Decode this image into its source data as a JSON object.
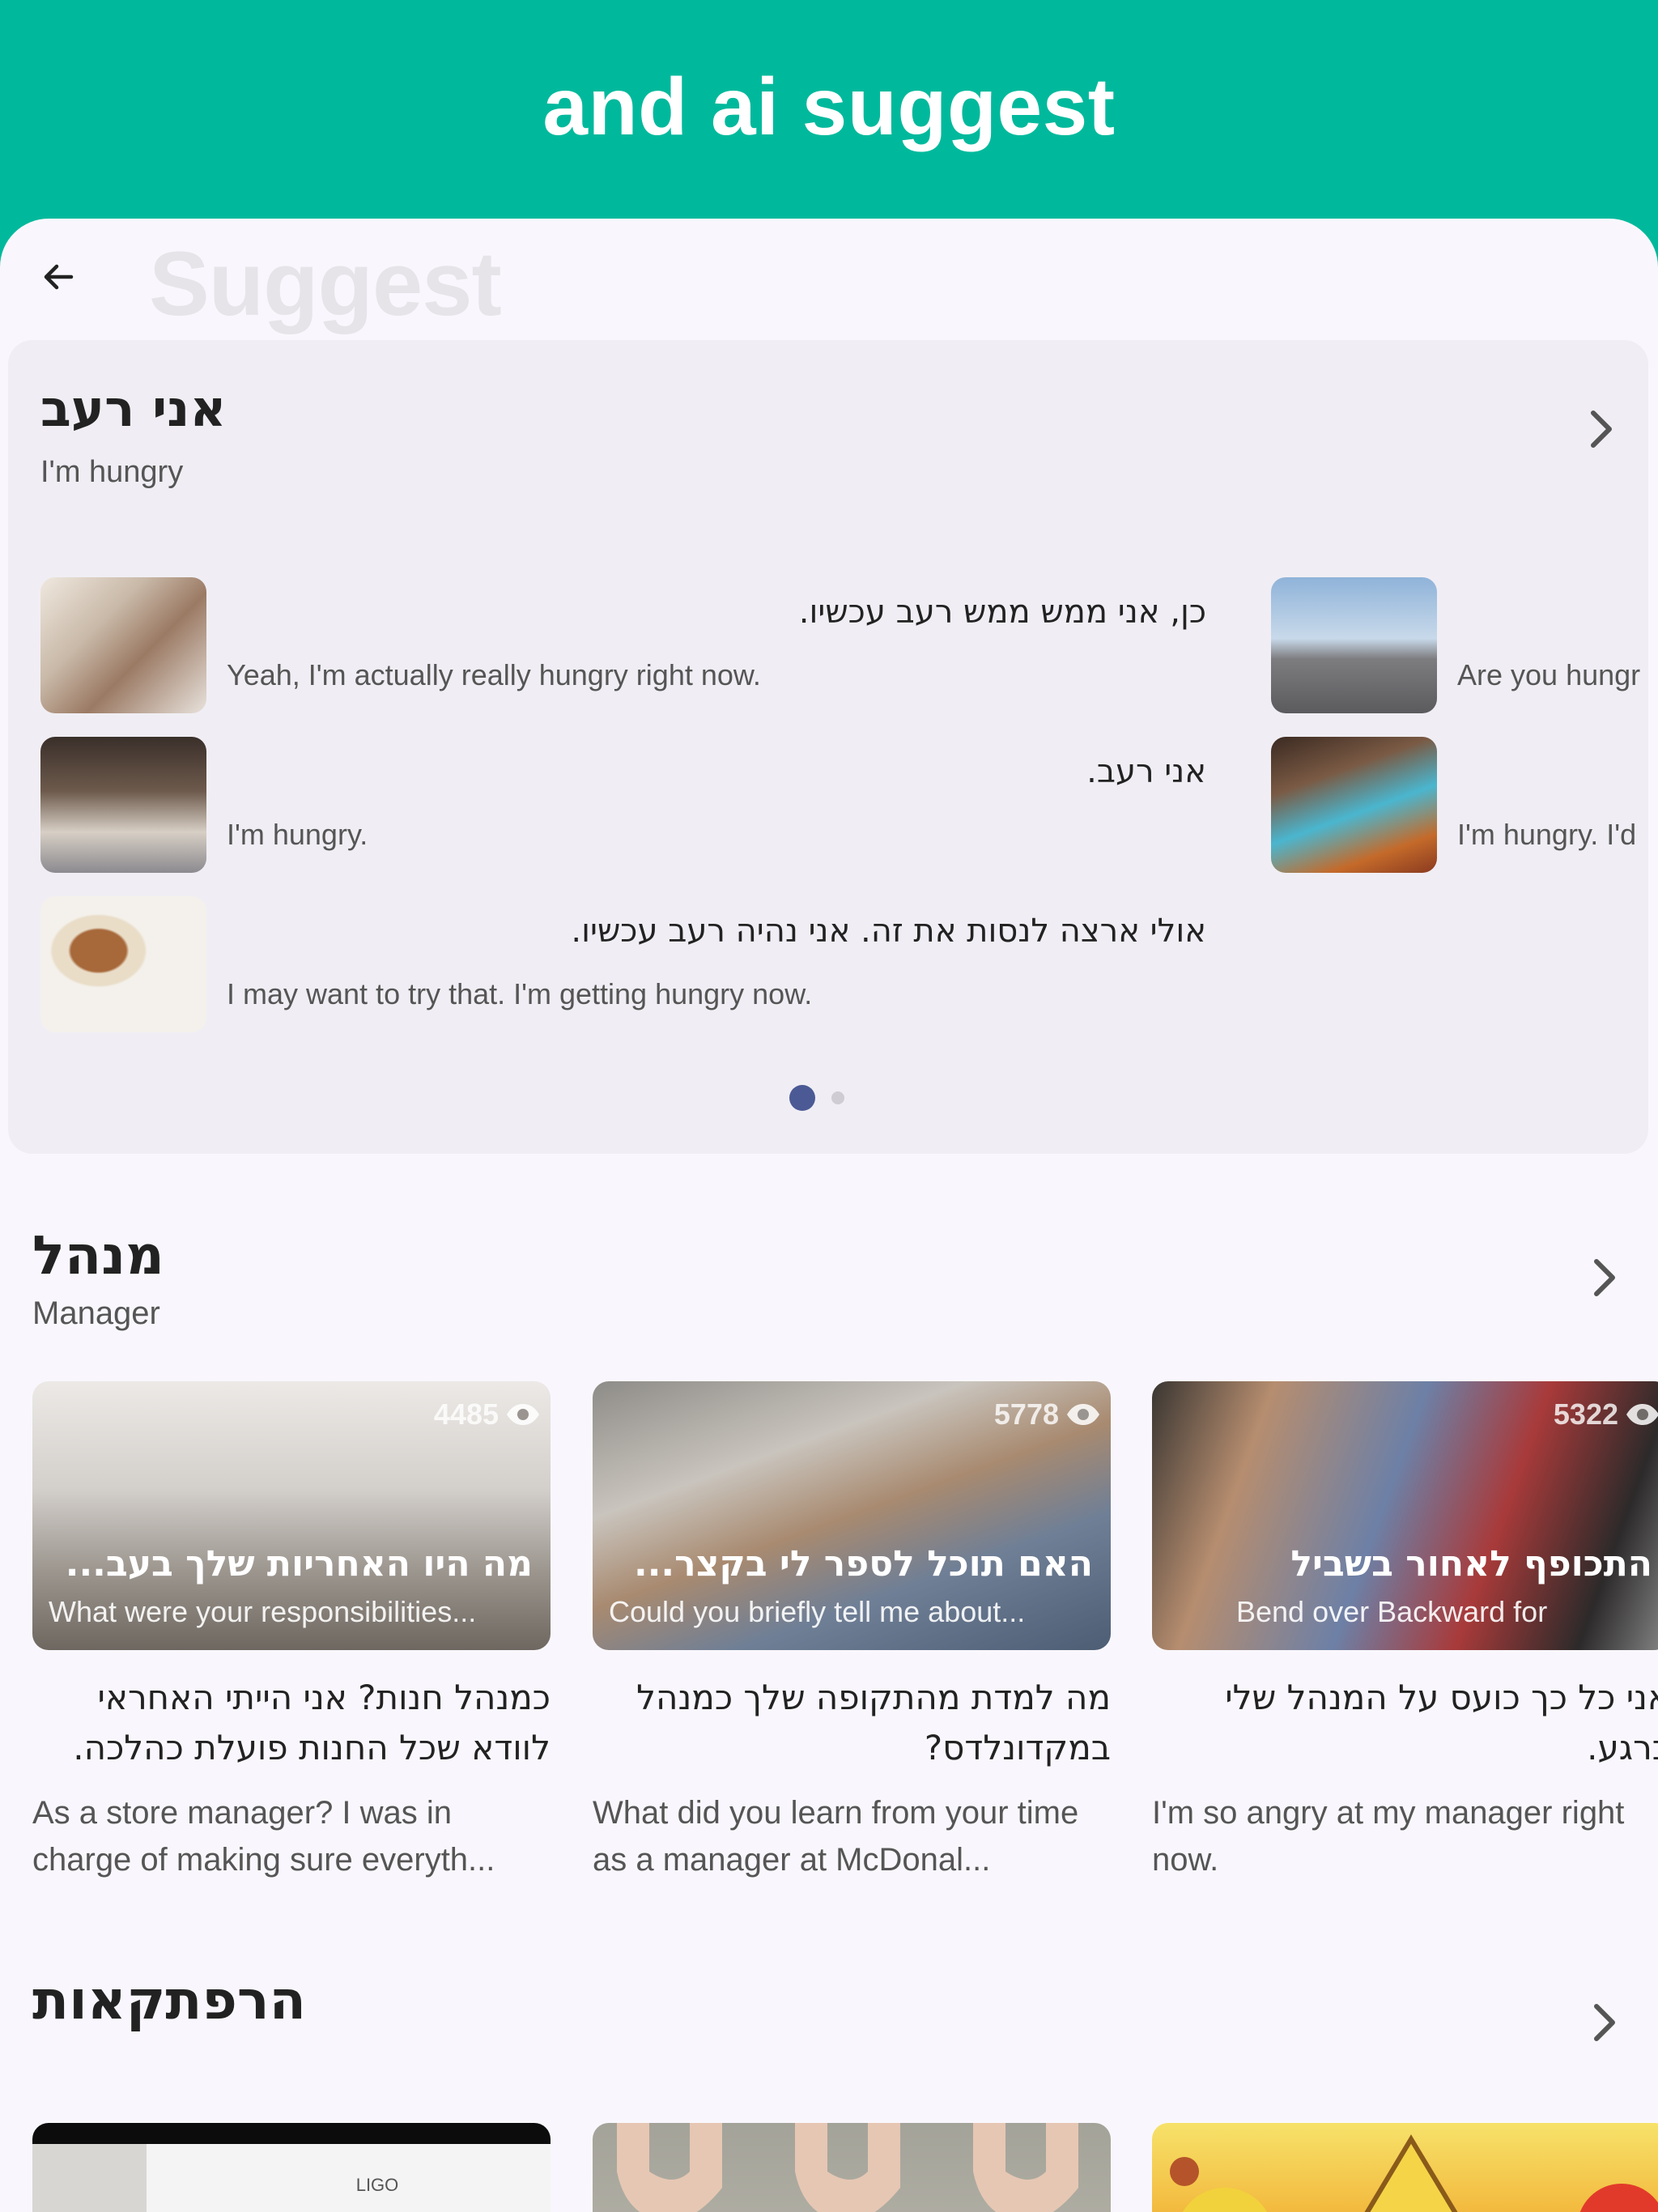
{
  "banner": {
    "title": "and ai suggest"
  },
  "header": {
    "title": "Suggest"
  },
  "featured": {
    "title_he": "אני רעב",
    "title_en": "I'm hungry",
    "rows": [
      {
        "he": "כן, אני ממש ממש רעב עכשיו.",
        "en": "Yeah, I'm actually really hungry right now."
      },
      {
        "he": "אני רעב.",
        "en": "I'm hungry."
      },
      {
        "he": "אולי ארצה לנסות את זה. אני נהיה רעב עכשיו.",
        "en": "I may want to try that. I'm getting hungry now."
      }
    ],
    "rows_right": [
      {
        "en": "Are you hungr"
      },
      {
        "en": "I'm hungry. I'd"
      }
    ],
    "pagination": {
      "current": 1,
      "total": 2
    }
  },
  "section_manager": {
    "title_he": "מנהל",
    "title_en": "Manager",
    "cards": [
      {
        "views": "4485",
        "overlay_he": "מה היו האחריות שלך בעב...",
        "overlay_en": "What were your responsibilities...",
        "body_he": "כמנהל חנות? אני הייתי האחראי לוודא שכל החנות פועלת כהלכה.",
        "body_en": "As a store manager? I was in charge of making sure everyth..."
      },
      {
        "views": "5778",
        "overlay_he": "האם תוכל לספר לי בקצר...",
        "overlay_en": "Could you briefly tell me about...",
        "body_he": "מה למדת מהתקופה שלך כמנהל במקדונלדס?",
        "body_en": "What did you learn from your time as a manager at McDonal..."
      },
      {
        "views": "5322",
        "overlay_he": "התכופף לאחור בשביל",
        "overlay_en": "Bend over Backward for",
        "body_he": "אני כל כך כועס על המנהל שלי כרגע.",
        "body_en": "I'm so angry at my manager right now."
      }
    ]
  },
  "section_adventures": {
    "title_he": "הרפתקאות",
    "cards": [
      {
        "logo_text": "LIGO"
      },
      {},
      {}
    ]
  },
  "colors": {
    "brand": "#00b99c",
    "dot_active": "#4b5a95",
    "background": "#f9f7fd"
  }
}
